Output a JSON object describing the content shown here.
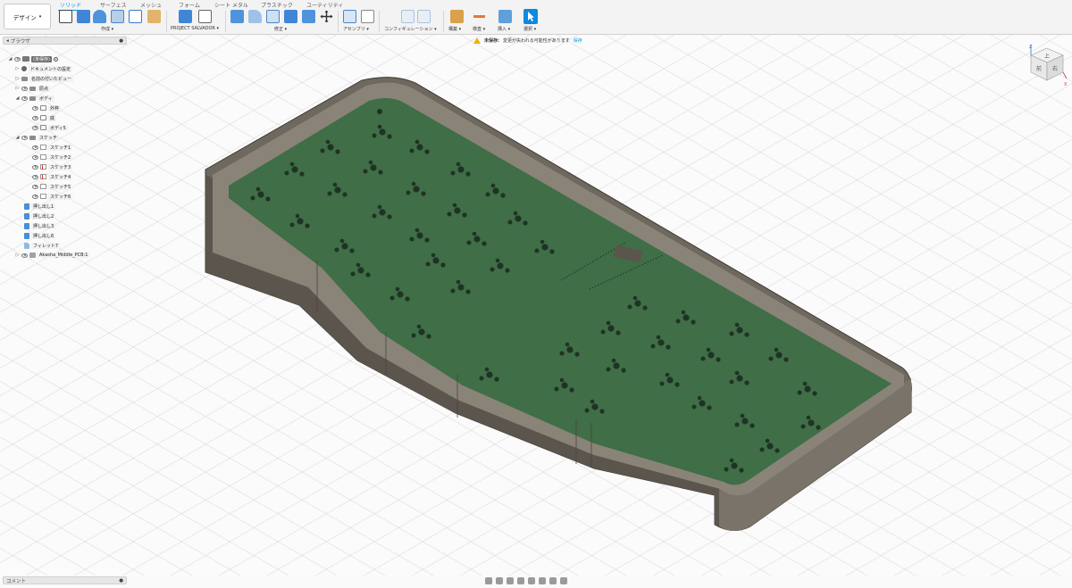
{
  "toolbar": {
    "workspace": "デザイン",
    "tabs": [
      {
        "label": "ソリッド",
        "active": true
      },
      {
        "label": "サーフェス",
        "active": false
      },
      {
        "label": "メッシュ",
        "active": false
      },
      {
        "label": "フォーム",
        "active": false
      },
      {
        "label": "シート メタル",
        "active": false
      },
      {
        "label": "プラスチック",
        "active": false
      },
      {
        "label": "ユーティリティ",
        "active": false
      }
    ],
    "groups": {
      "create": "作成 ▾",
      "salvador": "PROJECT SALVADOR ▾",
      "modify": "修正 ▾",
      "assemble": "アセンブリ ▾",
      "configure": "コンフィギュレーション ▾",
      "construct": "構築 ▾",
      "inspect": "検査 ▾",
      "insert": "挿入 ▾",
      "select": "選択 ▾"
    },
    "accent": "#0696d7"
  },
  "browser": {
    "title": "ブラウザ",
    "root_label": "(未保存)",
    "items": [
      {
        "label": "ドキュメントの設定",
        "icon": "gear-icon"
      },
      {
        "label": "名前の付いたビュー",
        "icon": "folder-icon"
      },
      {
        "label": "原点",
        "icon": "folder-icon"
      },
      {
        "label": "ボディ",
        "icon": "folder-icon"
      },
      {
        "label": "外枠",
        "icon": "body-icon"
      },
      {
        "label": "底",
        "icon": "body-icon"
      },
      {
        "label": "ボディ5",
        "icon": "body-icon"
      },
      {
        "label": "スケッチ",
        "icon": "folder-icon"
      },
      {
        "label": "スケッチ1",
        "icon": "sketch-icon"
      },
      {
        "label": "スケッチ2",
        "icon": "sketch-icon"
      },
      {
        "label": "スケッチ3",
        "icon": "sketch-icon"
      },
      {
        "label": "スケッチ4",
        "icon": "sketch-icon"
      },
      {
        "label": "スケッチ5",
        "icon": "sketch-icon"
      },
      {
        "label": "スケッチ6",
        "icon": "sketch-icon"
      },
      {
        "label": "押し出し1",
        "icon": "extrude-icon"
      },
      {
        "label": "押し出し2",
        "icon": "extrude-icon"
      },
      {
        "label": "押し出し3",
        "icon": "extrude-icon"
      },
      {
        "label": "押し出し6",
        "icon": "extrude-icon"
      },
      {
        "label": "フィレット7",
        "icon": "fillet-icon"
      },
      {
        "label": "Akasha_Middle_PCB:1",
        "icon": "component-icon"
      }
    ]
  },
  "notice": {
    "label": "未保存:",
    "message": "変更が失われる可能性があります",
    "action": "保存"
  },
  "viewcube": {
    "top": "上",
    "front": "前",
    "right": "右",
    "axis_x": "X",
    "axis_z": "Z"
  },
  "comments": {
    "title": "コメント"
  },
  "colors": {
    "pcb": "#3f6e47",
    "case_wall": "#6e675e"
  }
}
